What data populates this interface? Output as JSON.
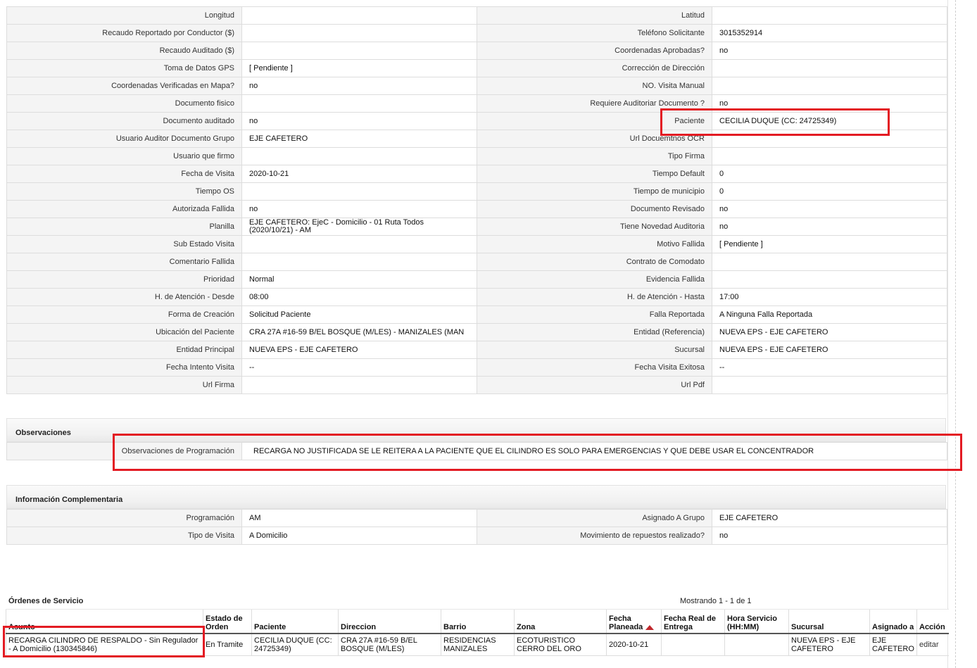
{
  "details": [
    {
      "l1": "Longitud",
      "v1": "",
      "l2": "Latitud",
      "v2": ""
    },
    {
      "l1": "Recaudo Reportado por Conductor ($)",
      "v1": "",
      "l2": "Teléfono Solicitante",
      "v2": "3015352914"
    },
    {
      "l1": "Recaudo Auditado ($)",
      "v1": "",
      "l2": "Coordenadas Aprobadas?",
      "v2": "no"
    },
    {
      "l1": "Toma de Datos GPS",
      "v1": "[ Pendiente ]",
      "l2": "Corrección de Dirección",
      "v2": ""
    },
    {
      "l1": "Coordenadas Verificadas en Mapa?",
      "v1": "no",
      "l2": "NO. Visita Manual",
      "v2": ""
    },
    {
      "l1": "Documento fisico",
      "v1": "",
      "l2": "Requiere Auditoriar Documento ?",
      "v2": "no"
    },
    {
      "l1": "Documento auditado",
      "v1": "no",
      "l2": "Paciente",
      "v2": "CECILIA DUQUE (CC: 24725349)"
    },
    {
      "l1": "Usuario Auditor Documento Grupo",
      "v1": "EJE CAFETERO",
      "l2": "Url Docuemtnos OCR",
      "v2": ""
    },
    {
      "l1": "Usuario que firmo",
      "v1": "",
      "l2": "Tipo Firma",
      "v2": ""
    },
    {
      "l1": "Fecha de Visita",
      "v1": "2020-10-21",
      "l2": "Tiempo Default",
      "v2": "0"
    },
    {
      "l1": "Tiempo OS",
      "v1": "",
      "l2": "Tiempo de municipio",
      "v2": "0"
    },
    {
      "l1": "Autorizada Fallida",
      "v1": "no",
      "l2": "Documento Revisado",
      "v2": "no"
    },
    {
      "l1": "Planilla",
      "v1a": "EJE CAFETERO: EjeC - Domicilio - 01 Ruta Todos",
      "v1b": "(2020/10/21) - AM",
      "l2": "Tiene Novedad Auditoria",
      "v2": "no"
    },
    {
      "l1": "Sub Estado Visita",
      "v1": "",
      "l2": "Motivo Fallida",
      "v2": "[ Pendiente ]"
    },
    {
      "l1": "Comentario Fallida",
      "v1": "",
      "l2": "Contrato de Comodato",
      "v2": ""
    },
    {
      "l1": "Prioridad",
      "v1": "Normal",
      "l2": "Evidencia Fallida",
      "v2": ""
    },
    {
      "l1": "H. de Atención - Desde",
      "v1": "08:00",
      "l2": "H. de Atención - Hasta",
      "v2": "17:00"
    },
    {
      "l1": "Forma de Creación",
      "v1": "Solicitud Paciente",
      "l2": "Falla Reportada",
      "v2": "A Ninguna Falla Reportada"
    },
    {
      "l1": "Ubicación del Paciente",
      "v1": "CRA 27A #16-59 B/EL BOSQUE (M/LES) - MANIZALES (MAN",
      "l2": "Entidad (Referencia)",
      "v2": "NUEVA EPS - EJE CAFETERO"
    },
    {
      "l1": "Entidad Principal",
      "v1": "NUEVA EPS - EJE CAFETERO",
      "l2": "Sucursal",
      "v2": "NUEVA EPS - EJE CAFETERO"
    },
    {
      "l1": "Fecha Intento Visita",
      "v1": "--",
      "l2": "Fecha Visita Exitosa",
      "v2": "--"
    },
    {
      "l1": "Url Firma",
      "v1": "",
      "l2": "Url Pdf",
      "v2": ""
    }
  ],
  "observaciones": {
    "title": "Observaciones",
    "label": "Observaciones de Programación",
    "value": "RECARGA NO JUSTIFICADA SE LE REITERA A LA PACIENTE QUE EL CILINDRO ES SOLO PARA EMERGENCIAS Y QUE DEBE USAR EL CONCENTRADOR"
  },
  "complementaria": {
    "title": "Información Complementaria",
    "rows": [
      {
        "l1": "Programación",
        "v1": "AM",
        "l2": "Asignado A Grupo",
        "v2": "EJE CAFETERO"
      },
      {
        "l1": "Tipo de Visita",
        "v1": "A Domicilio",
        "l2": "Movimiento de repuestos realizado?",
        "v2": "no"
      }
    ]
  },
  "orders": {
    "title": "Órdenes de Servicio",
    "count": "Mostrando 1 - 1 de 1",
    "headers": {
      "asunto": "Asunto",
      "estado": "Estado de Orden",
      "paciente": "Paciente",
      "direccion": "Direccion",
      "barrio": "Barrio",
      "zona": "Zona",
      "fecha_planeada": "Fecha Planeada",
      "fecha_real": "Fecha Real de Entrega",
      "hora": "Hora Servicio (HH:MM)",
      "sucursal": "Sucursal",
      "asignado": "Asignado a",
      "accion": "Acción"
    },
    "row": {
      "asunto": "RECARGA CILINDRO DE RESPALDO - Sin Regulador - A Domicilio (130345846)",
      "estado": "En Tramite",
      "paciente": "CECILIA DUQUE (CC: 24725349)",
      "direccion": "CRA 27A #16-59 B/EL BOSQUE (M/LES)",
      "barrio": "RESIDENCIAS MANIZALES",
      "zona": "ECOTURISTICO CERRO DEL ORO",
      "fecha_planeada": "2020-10-21",
      "fecha_real": "",
      "hora": "",
      "sucursal": "NUEVA EPS - EJE CAFETERO",
      "asignado": "EJE CAFETERO",
      "accion": "editar"
    }
  },
  "colors": {
    "highlight": "#e31b23",
    "sort_arrow": "#c0282d"
  }
}
